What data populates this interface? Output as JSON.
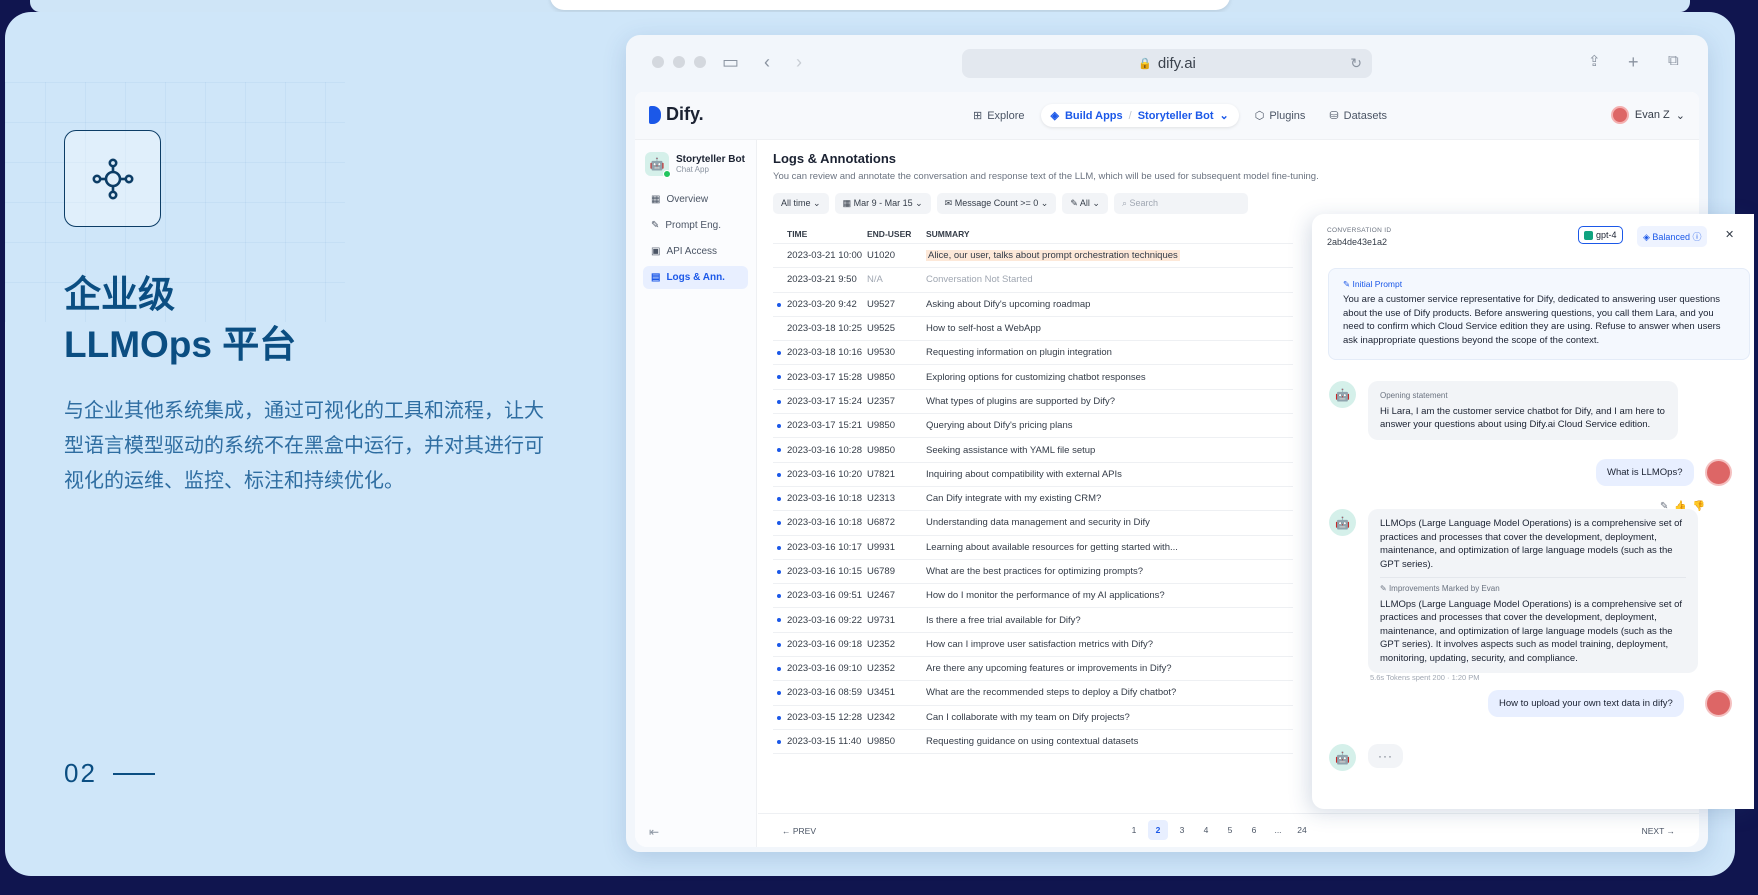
{
  "hero": {
    "title_line1": "企业级",
    "title_line2": "LLMOps 平台",
    "subtitle": "与企业其他系统集成，通过可视化的工具和流程，让大型语言模型驱动的系统不在黑盒中运行，并对其进行可视化的运维、监控、标注和持续优化。",
    "page_number": "02",
    "icon": "nodes-network-icon"
  },
  "browser": {
    "url": "dify.ai",
    "icons": [
      "sidebar-icon",
      "back-icon",
      "forward-icon",
      "lock-icon",
      "reload-icon",
      "share-icon",
      "new-tab-icon",
      "tabs-icon"
    ]
  },
  "appbar": {
    "logo": "Dify.",
    "nav": {
      "explore": "Explore",
      "build_apps": "Build Apps",
      "current_app": "Storyteller Bot",
      "plugins": "Plugins",
      "datasets": "Datasets"
    },
    "user": "Evan Z"
  },
  "sidebar": {
    "app_name": "Storyteller Bot",
    "app_type": "Chat App",
    "items": [
      "Overview",
      "Prompt Eng.",
      "API Access",
      "Logs & Ann."
    ]
  },
  "main": {
    "title": "Logs & Annotations",
    "description": "You can review and annotate the conversation and response text of the LLM, which will be used for subsequent model fine-tuning.",
    "filters": {
      "time": "All time",
      "date_range": "Mar 9 - Mar 15",
      "message_count": "Message Count >= 0",
      "tag": "All",
      "search_placeholder": "Search"
    },
    "columns": [
      "TIME",
      "END-USER",
      "SUMMARY"
    ],
    "rows": [
      {
        "time": "2023-03-21 10:00",
        "user": "U1020",
        "summary": "Alice, our user, talks about prompt orchestration techniques",
        "unread": false
      },
      {
        "time": "2023-03-21 9:50",
        "user": "N/A",
        "summary": "Conversation Not Started",
        "unread": false
      },
      {
        "time": "2023-03-20 9:42",
        "user": "U9527",
        "summary": "Asking about Dify's upcoming roadmap",
        "unread": true
      },
      {
        "time": "2023-03-18 10:25",
        "user": "U9525",
        "summary": "How to self-host a WebApp",
        "unread": false
      },
      {
        "time": "2023-03-18 10:16",
        "user": "U9530",
        "summary": "Requesting information on plugin integration",
        "unread": true
      },
      {
        "time": "2023-03-17 15:28",
        "user": "U9850",
        "summary": "Exploring options for customizing chatbot responses",
        "unread": true
      },
      {
        "time": "2023-03-17 15:24",
        "user": "U2357",
        "summary": "What types of plugins are supported by Dify?",
        "unread": true
      },
      {
        "time": "2023-03-17 15:21",
        "user": "U9850",
        "summary": "Querying about Dify's pricing plans",
        "unread": true
      },
      {
        "time": "2023-03-16 10:28",
        "user": "U9850",
        "summary": "Seeking assistance with YAML file setup",
        "unread": true
      },
      {
        "time": "2023-03-16 10:20",
        "user": "U7821",
        "summary": "Inquiring about compatibility with external APIs",
        "unread": true
      },
      {
        "time": "2023-03-16 10:18",
        "user": "U2313",
        "summary": "Can Dify integrate with my existing CRM?",
        "unread": true
      },
      {
        "time": "2023-03-16 10:18",
        "user": "U6872",
        "summary": "Understanding data management and security in Dify",
        "unread": true
      },
      {
        "time": "2023-03-16 10:17",
        "user": "U9931",
        "summary": "Learning about available resources for getting started with...",
        "unread": true
      },
      {
        "time": "2023-03-16 10:15",
        "user": "U6789",
        "summary": "What are the best practices for optimizing prompts?",
        "unread": true
      },
      {
        "time": "2023-03-16 09:51",
        "user": "U2467",
        "summary": "How do I monitor the performance of my AI applications?",
        "unread": true
      },
      {
        "time": "2023-03-16 09:22",
        "user": "U9731",
        "summary": "Is there a free trial available for Dify?",
        "unread": true
      },
      {
        "time": "2023-03-16 09:18",
        "user": "U2352",
        "summary": "How can I improve user satisfaction metrics with Dify?",
        "unread": true
      },
      {
        "time": "2023-03-16 09:10",
        "user": "U2352",
        "summary": "Are there any upcoming features or improvements in Dify?",
        "unread": true
      },
      {
        "time": "2023-03-16 08:59",
        "user": "U3451",
        "summary": "What are the recommended steps to deploy a Dify chatbot?",
        "unread": true
      },
      {
        "time": "2023-03-15 12:28",
        "user": "U2342",
        "summary": "Can I collaborate with my team on Dify projects?",
        "unread": true
      },
      {
        "time": "2023-03-15 11:40",
        "user": "U9850",
        "summary": "Requesting guidance on using contextual datasets",
        "unread": true
      }
    ],
    "pager": {
      "prev": "PREV",
      "next": "NEXT",
      "pages": [
        "1",
        "2",
        "3",
        "4",
        "5",
        "6",
        "...",
        "24"
      ],
      "current": "2"
    }
  },
  "conversation": {
    "id_label": "CONVERSATION ID",
    "id": "2ab4de43e1a2",
    "model": "gpt-4",
    "mode": "Balanced",
    "initial_prompt_label": "Initial Prompt",
    "initial_prompt": "You are a customer service representative for Dify, dedicated to answering user questions about the use of Dify products. Before answering questions, you call them Lara, and you need to confirm which Cloud Service edition they are using. Refuse to answer when users ask inappropriate questions beyond the scope of the context.",
    "opening_label": "Opening statement",
    "opening": "Hi Lara, I am the customer service chatbot for Dify, and I am here to answer your questions about using Dify.ai Cloud Service edition.",
    "user_q1": "What is LLMOps?",
    "answer1": "LLMOps (Large Language Model Operations) is a comprehensive set of practices and processes that cover the development, deployment, maintenance, and optimization of large language models (such as the GPT series).",
    "improve_label": "Improvements Marked by Evan",
    "improved": "LLMOps (Large Language Model Operations) is a comprehensive set of practices and processes that cover the development, deployment, maintenance, and optimization of large language models (such as the GPT series).  It involves aspects such as model training, deployment, monitoring, updating, security, and compliance.",
    "meta": "5.6s   Tokens spent 200   ·   1:20 PM",
    "user_q2": "How to upload your own text data in dify?",
    "typing": "···"
  }
}
